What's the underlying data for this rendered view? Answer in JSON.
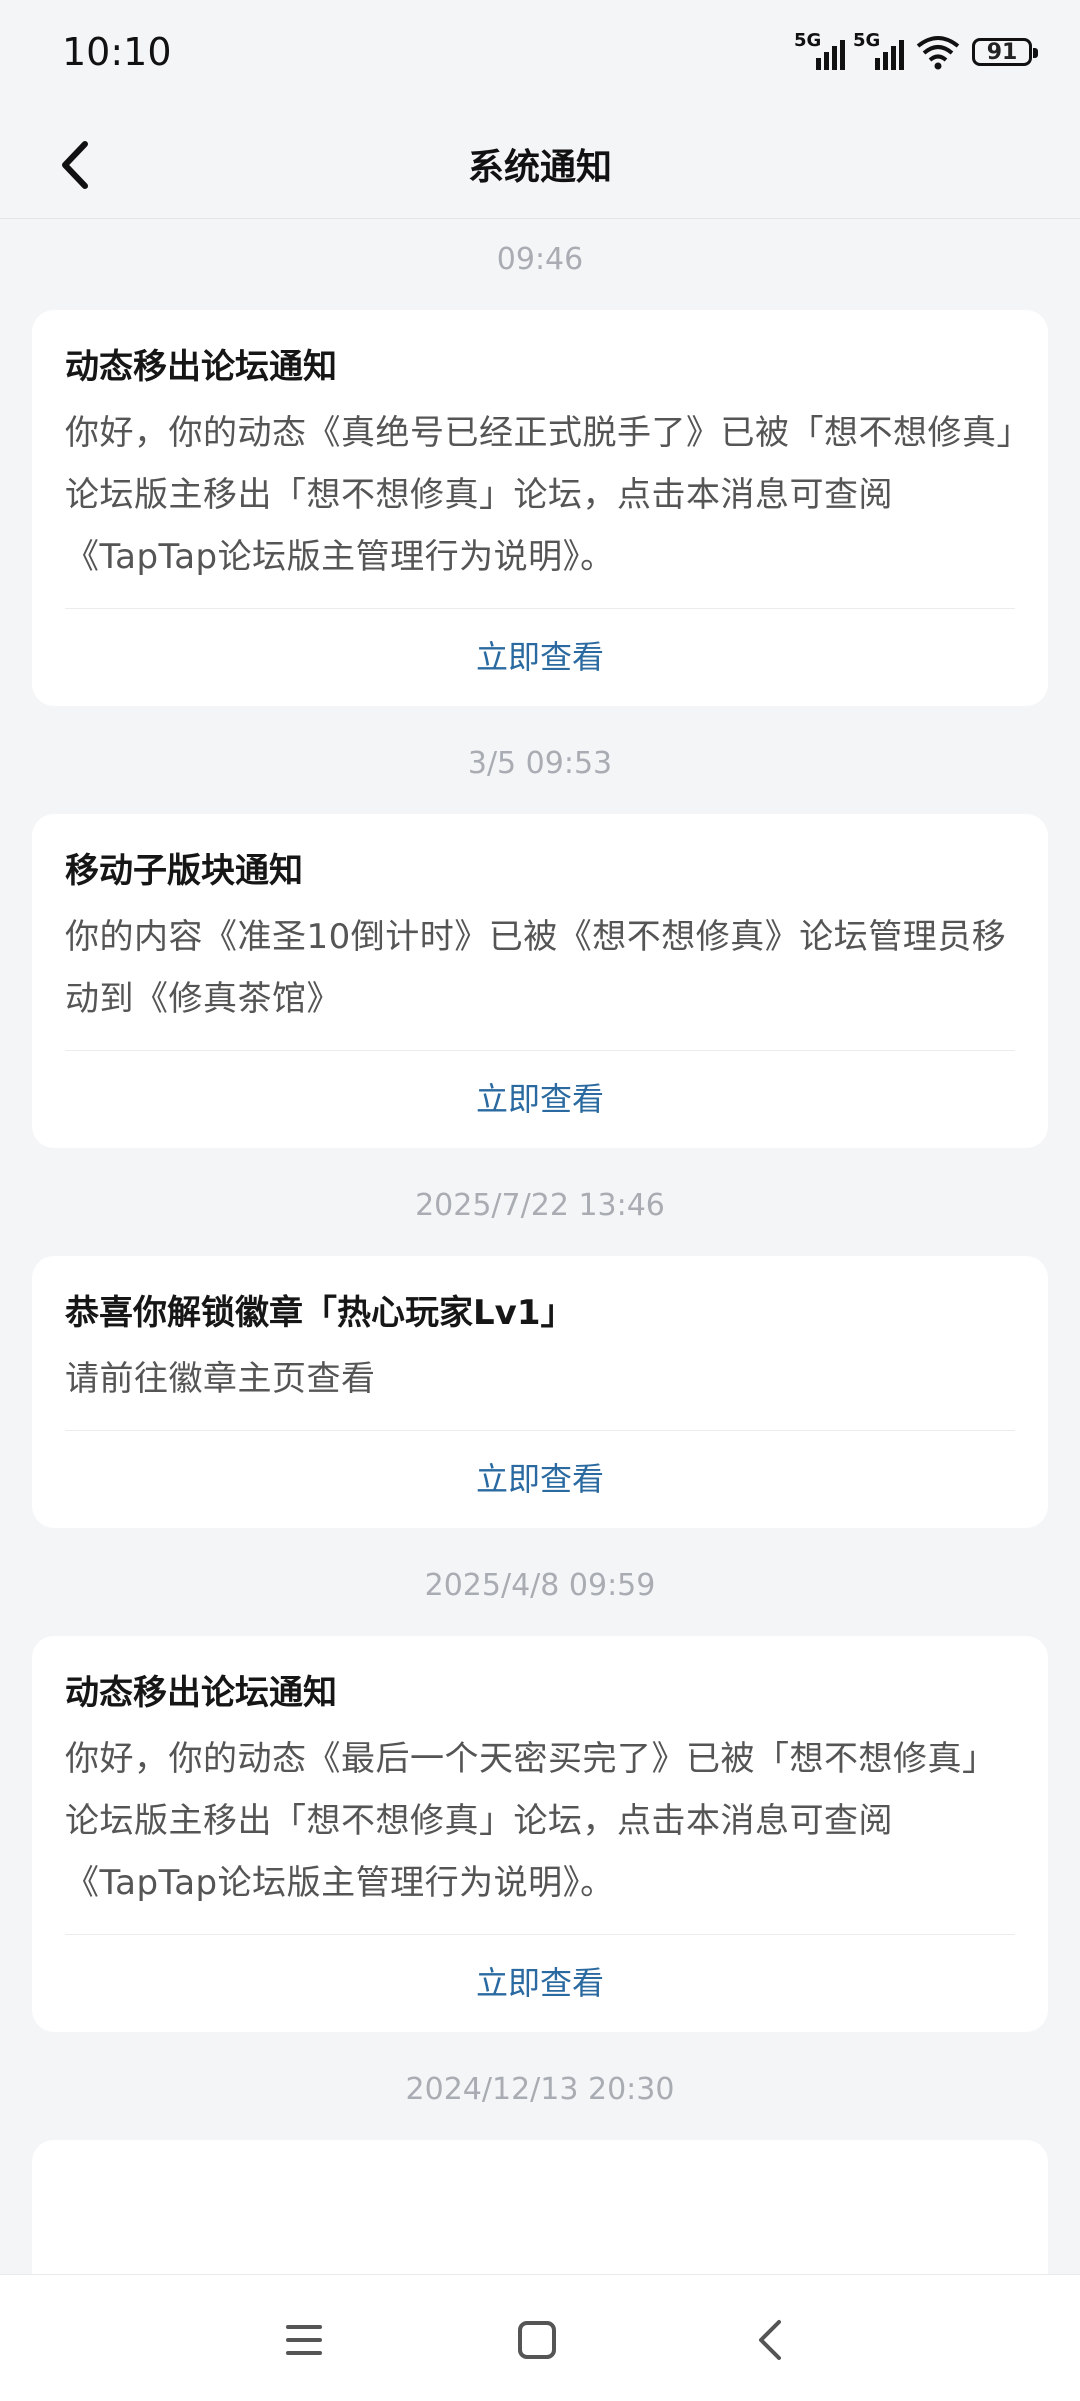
{
  "status_bar": {
    "time": "10:10",
    "signal1_label": "5G",
    "signal2_label": "5G",
    "battery": "91",
    "icons": [
      "signal-icon",
      "signal-icon",
      "wifi-icon",
      "battery-icon"
    ]
  },
  "header": {
    "title": "系统通知",
    "back_icon": "chevron-left-icon"
  },
  "notifications": [
    {
      "timestamp": "09:46",
      "title": "动态移出论坛通知",
      "body": "你好，你的动态《真绝号已经正式脱手了》已被「想不想修真」论坛版主移出「想不想修真」论坛，点击本消息可查阅《TapTap论坛版主管理行为说明》。",
      "action": "立即查看"
    },
    {
      "timestamp": "3/5  09:53",
      "title": "移动子版块通知",
      "body": "你的内容《准圣10倒计时》已被《想不想修真》论坛管理员移动到《修真茶馆》",
      "action": "立即查看"
    },
    {
      "timestamp": "2025/7/22  13:46",
      "title": "恭喜你解锁徽章「热心玩家Lv1」",
      "body": "请前往徽章主页查看",
      "action": "立即查看"
    },
    {
      "timestamp": "2025/4/8  09:59",
      "title": "动态移出论坛通知",
      "body": "你好，你的动态《最后一个天密买完了》已被「想不想修真」论坛版主移出「想不想修真」论坛，点击本消息可查阅《TapTap论坛版主管理行为说明》。",
      "action": "立即查看"
    },
    {
      "timestamp": "2024/12/13  20:30"
    }
  ],
  "nav_bar": {
    "icons": [
      "menu-icon",
      "home-square-icon",
      "back-triangle-icon"
    ]
  },
  "colors": {
    "background": "#f4f5f7",
    "card": "#ffffff",
    "action_link": "#2a6aa0",
    "timestamp": "#a9adb3"
  }
}
